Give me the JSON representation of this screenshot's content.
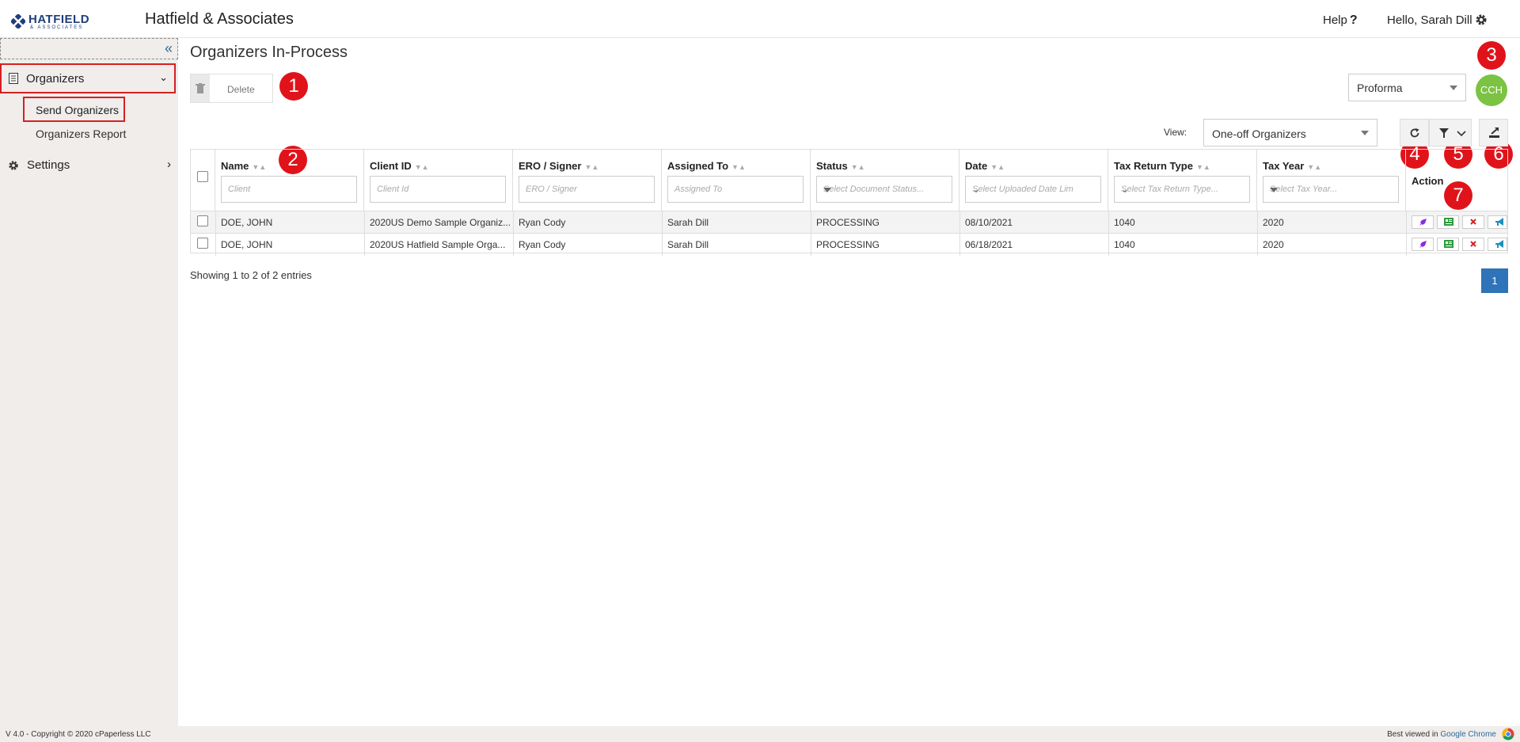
{
  "header": {
    "logo_name": "HATFIELD",
    "logo_sub": "& ASSOCIATES",
    "app_title": "Hatfield & Associates",
    "help_label": "Help",
    "help_icon": "?",
    "greeting": "Hello, Sarah Dill"
  },
  "sidebar": {
    "collapse_icon": "«",
    "organizers_label": "Organizers",
    "send_label": "Send Organizers",
    "report_label": "Organizers Report",
    "settings_label": "Settings"
  },
  "main": {
    "title": "Organizers In-Process",
    "delete_label": "Delete",
    "proforma_value": "Proforma",
    "cch_label": "CCH",
    "view_label": "View:",
    "view_value": "One-off Organizers"
  },
  "badges": [
    "1",
    "2",
    "3",
    "4",
    "5",
    "6",
    "7"
  ],
  "table": {
    "columns": [
      {
        "label": "Name",
        "placeholder": "Client"
      },
      {
        "label": "Client ID",
        "placeholder": "Client Id"
      },
      {
        "label": "ERO / Signer",
        "placeholder": "ERO / Signer"
      },
      {
        "label": "Assigned To",
        "placeholder": "Assigned To"
      },
      {
        "label": "Status",
        "placeholder": "Select Document Status..."
      },
      {
        "label": "Date",
        "placeholder": "Select Uploaded Date Lim"
      },
      {
        "label": "Tax Return Type",
        "placeholder": "Select Tax Return Type..."
      },
      {
        "label": "Tax Year",
        "placeholder": "Select Tax Year..."
      }
    ],
    "action_label": "Action",
    "rows": [
      {
        "name": "DOE, JOHN",
        "client_id": "2020US Demo Sample Organiz...",
        "ero": "Ryan Cody",
        "assigned": "Sarah Dill",
        "status": "PROCESSING",
        "date": "08/10/2021",
        "type": "1040",
        "year": "2020"
      },
      {
        "name": "DOE, JOHN",
        "client_id": "2020US Hatfield Sample Orga...",
        "ero": "Ryan Cody",
        "assigned": "Sarah Dill",
        "status": "PROCESSING",
        "date": "06/18/2021",
        "type": "1040",
        "year": "2020"
      }
    ]
  },
  "pagination": {
    "showing": "Showing 1 to 2 of 2 entries",
    "current_page": "1"
  },
  "footer": {
    "copyright": "V 4.0 - Copyright © 2020 cPaperless LLC",
    "best_viewed": "Best viewed in",
    "browser": "Google Chrome"
  },
  "colors": {
    "accent_blue": "#2f73b8",
    "badge_red": "#e0131b",
    "highlight_red": "#d62020",
    "cch_green": "#7cc243",
    "sidebar_bg": "#f0edeb"
  },
  "icons": [
    "hatfield-logo-icon",
    "gear-icon",
    "double-chevron-left-icon",
    "document-icon",
    "chevron-down-icon",
    "chevron-right-icon",
    "trash-icon",
    "refresh-icon",
    "filter-icon",
    "export-icon",
    "rocket-icon",
    "id-card-icon",
    "close-icon",
    "megaphone-icon",
    "chrome-icon"
  ]
}
